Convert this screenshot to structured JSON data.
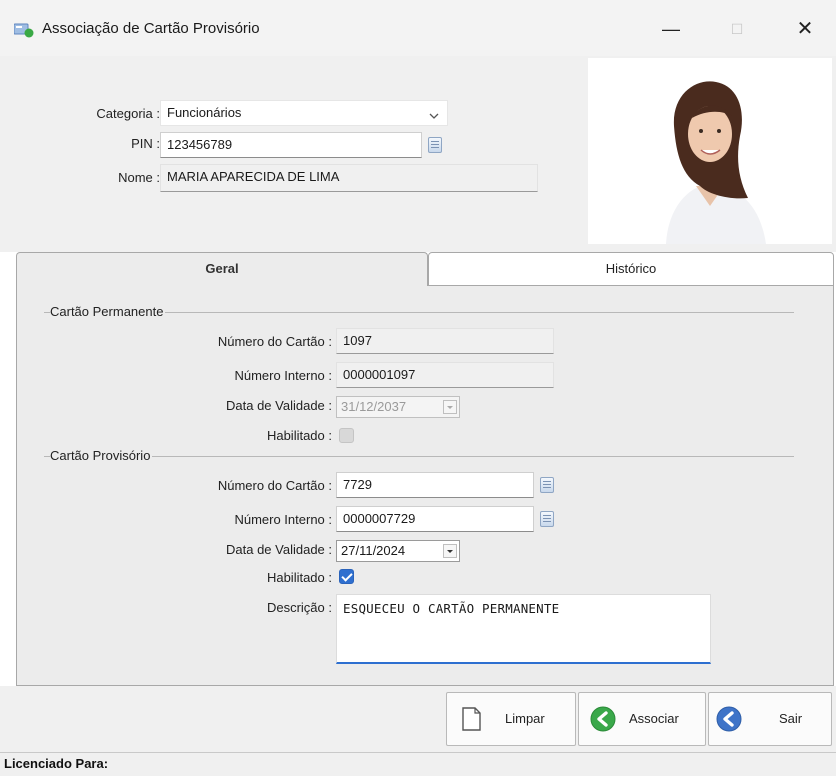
{
  "window": {
    "title": "Associação de Cartão Provisório",
    "minimize_symbol": "—",
    "maximize_symbol": "☐",
    "close_symbol": "✕"
  },
  "header": {
    "categoria_label": "Categoria :",
    "categoria_value": "Funcionários",
    "pin_label": "PIN :",
    "pin_value": "123456789",
    "nome_label": "Nome :",
    "nome_value": "MARIA APARECIDA DE LIMA"
  },
  "tabs": [
    {
      "label": "Geral",
      "active": true
    },
    {
      "label": "Histórico",
      "active": false
    }
  ],
  "cartao_permanente": {
    "group_title": "Cartão Permanente",
    "numero_label": "Número do Cartão :",
    "numero_value": "1097",
    "interno_label": "Número Interno :",
    "interno_value": "0000001097",
    "validade_label": "Data de Validade :",
    "validade_value": "31/12/2037",
    "habilitado_label": "Habilitado :",
    "habilitado_checked": true,
    "enabled": false
  },
  "cartao_provisorio": {
    "group_title": "Cartão Provisório",
    "numero_label": "Número do Cartão :",
    "numero_value": "7729",
    "interno_label": "Número Interno :",
    "interno_value": "0000007729",
    "validade_label": "Data de Validade :",
    "validade_value": "27/11/2024",
    "habilitado_label": "Habilitado :",
    "habilitado_checked": true,
    "descricao_label": "Descrição :",
    "descricao_value": "ESQUECEU O CARTÃO PERMANENTE"
  },
  "actions": {
    "limpar_label": "Limpar",
    "associar_label": "Associar",
    "sair_label": "Sair"
  },
  "status_bar": {
    "text": "Licenciado Para:"
  },
  "colors": {
    "accent": "#2f6fcf",
    "associar_icon": "#3aa84a",
    "sair_icon": "#3f74c8"
  },
  "icons": [
    "app-icon",
    "chevron-down-icon",
    "lookup-icon",
    "checkbox-icon",
    "document-icon",
    "associate-arrow-icon",
    "exit-arrow-icon"
  ]
}
